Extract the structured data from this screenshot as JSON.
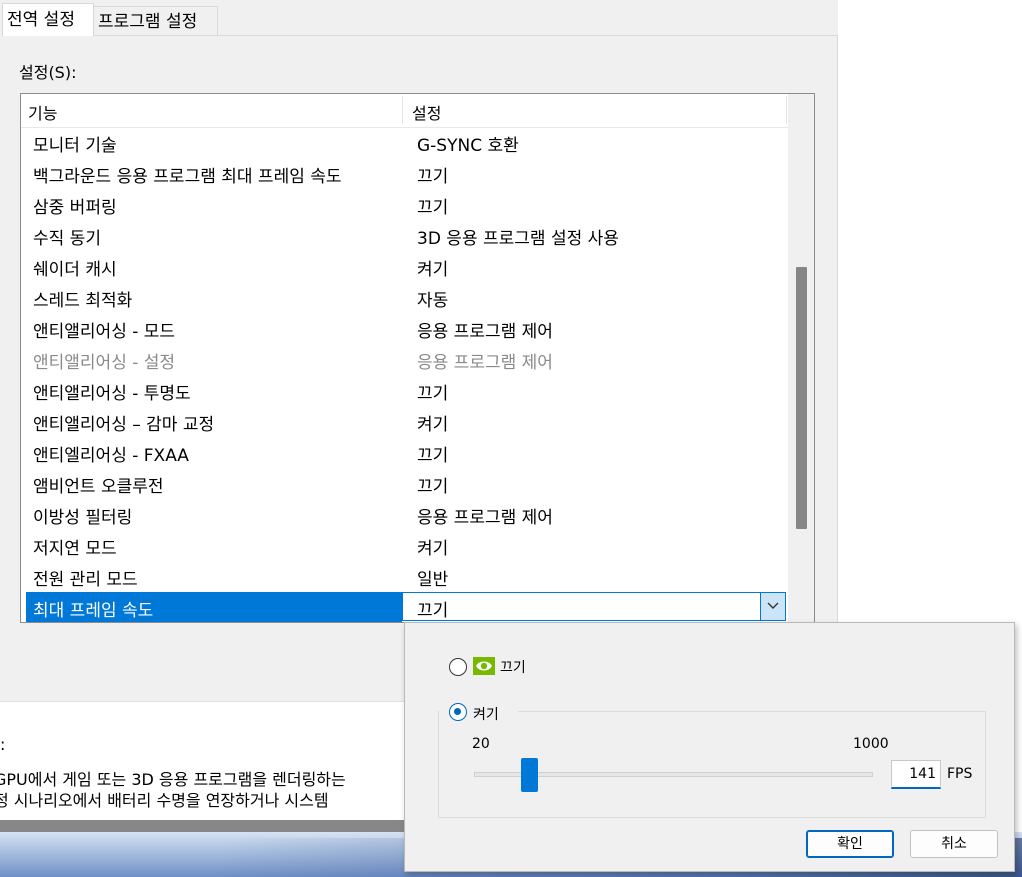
{
  "tabs": {
    "global": "전역 설정",
    "program": "프로그램 설정"
  },
  "settings_label": "설정(S):",
  "list_header": {
    "feature": "기능",
    "setting": "설정"
  },
  "rows": [
    {
      "feature": "모니터 기술",
      "value": "G-SYNC 호환"
    },
    {
      "feature": "백그라운드 응용 프로그램 최대 프레임 속도",
      "value": "끄기"
    },
    {
      "feature": "삼중 버퍼링",
      "value": "끄기"
    },
    {
      "feature": "수직 동기",
      "value": "3D 응용 프로그램 설정 사용"
    },
    {
      "feature": "쉐이더 캐시",
      "value": "켜기"
    },
    {
      "feature": "스레드 최적화",
      "value": "자동"
    },
    {
      "feature": "앤티앨리어싱 - 모드",
      "value": "응용 프로그램 제어"
    },
    {
      "feature": "앤티앨리어싱 - 설정",
      "value": "응용 프로그램 제어"
    },
    {
      "feature": "앤티앨리어싱 - 투명도",
      "value": "끄기"
    },
    {
      "feature": "앤티앨리어싱 – 감마 교정",
      "value": "켜기"
    },
    {
      "feature": "앤티엘리어싱 - FXAA",
      "value": "끄기"
    },
    {
      "feature": "앰비언트 오클루전",
      "value": "끄기"
    },
    {
      "feature": "이방성 필터링",
      "value": "응용 프로그램 제어"
    },
    {
      "feature": "저지연 모드",
      "value": "켜기"
    },
    {
      "feature": "전원 관리 모드",
      "value": "일반"
    }
  ],
  "selected_row": {
    "feature": "최대 프레임 속도",
    "value": "끄기"
  },
  "description": {
    "colon": ":",
    "line1": "GPU에서 게임 또는 3D 응용 프로그램을 렌더링하는",
    "line2": "정 시나리오에서 배터리 수명을 연장하거나 시스템"
  },
  "popup": {
    "option_off": "끄기",
    "option_on": "켜기",
    "selected_option": "on",
    "min": "20",
    "max": "1000",
    "fps_value": "141",
    "fps_unit": "FPS",
    "ok_label": "확인",
    "cancel_label": "취소"
  },
  "colors": {
    "accent": "#0078d7",
    "nvidia_green": "#76b900"
  }
}
